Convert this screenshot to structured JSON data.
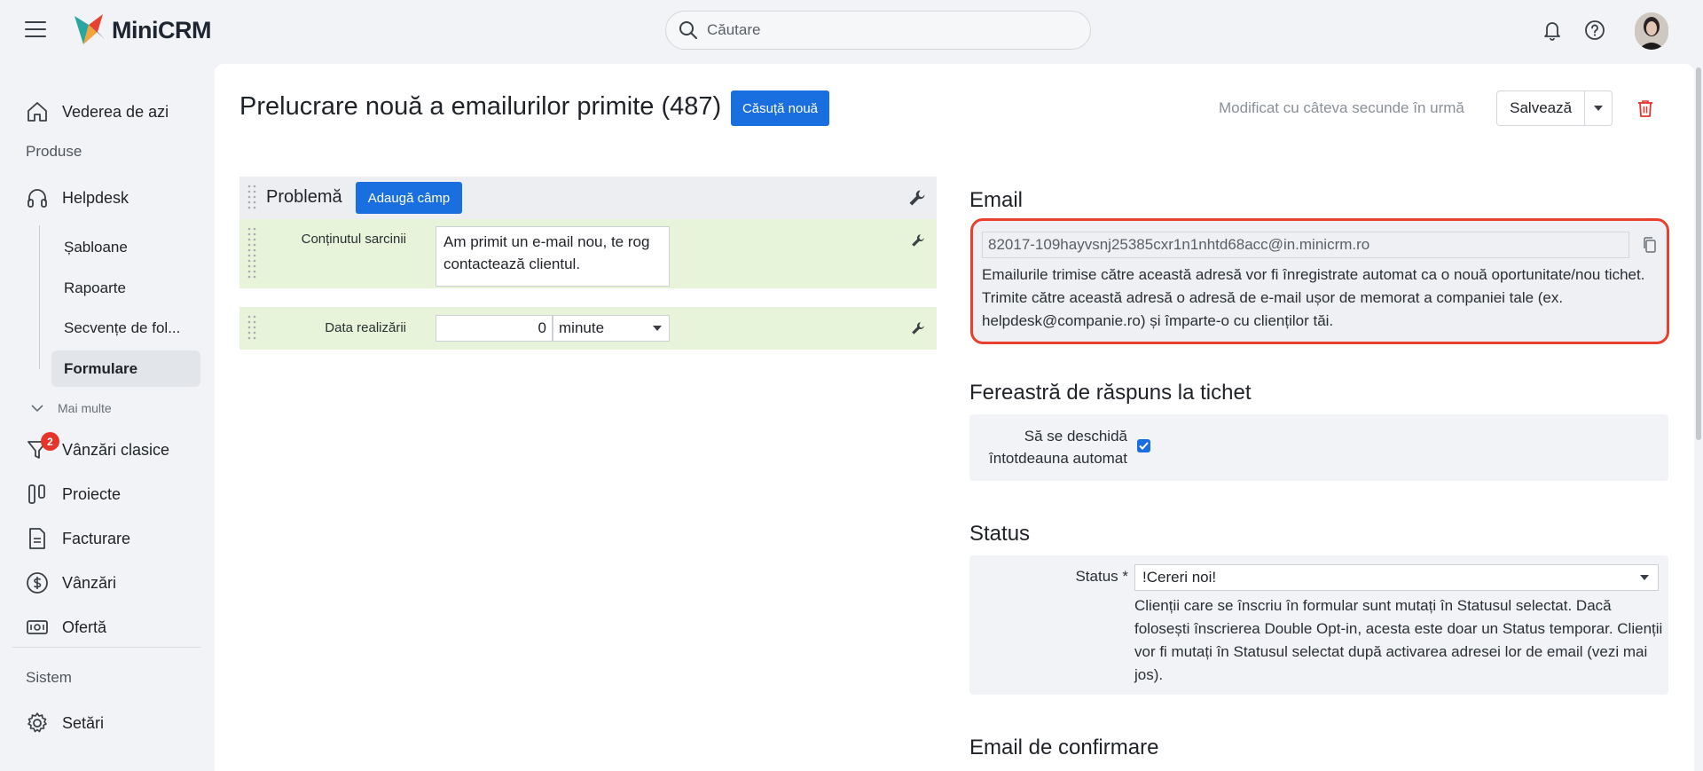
{
  "app": {
    "name": "MiniCRM"
  },
  "search": {
    "placeholder": "Căutare"
  },
  "topbar": {
    "icons": [
      "menu-icon",
      "bell-icon",
      "help-icon"
    ]
  },
  "sidebar": {
    "today": "Vederea de azi",
    "products_label": "Produse",
    "helpdesk": "Helpdesk",
    "sub_items": [
      "Șabloane",
      "Rapoarte",
      "Secvențe de fol...",
      "Formulare"
    ],
    "more": "Mai multe",
    "classic_sales": "Vânzări clasice",
    "classic_sales_badge": "2",
    "projects": "Proiecte",
    "invoicing": "Facturare",
    "sales": "Vânzări",
    "offer": "Ofertă",
    "system_label": "Sistem",
    "settings": "Setări"
  },
  "header": {
    "title": "Prelucrare nouă a emailurilor primite (487)",
    "new_box_label": "Căsuță nouă",
    "modified": "Modificat cu câteva secunde în urmă",
    "save_label": "Salvează"
  },
  "form": {
    "section_title": "Problemă",
    "add_field_label": "Adaugă câmp",
    "fields": [
      {
        "label": "Conținutul sarcinii",
        "value": "Am primit un e-mail nou, te rog contactează clientul."
      },
      {
        "label": "Data realizării",
        "number": "0",
        "unit": "minute"
      }
    ]
  },
  "email": {
    "title": "Email",
    "address": "82017-109hayvsnj25385cxr1n1nhtd68acc@in.minicrm.ro",
    "description": "Emailurile trimise către această adresă vor fi înregistrate automat ca o nouă oportunitate/nou tichet. Trimite către această adresă o adresă de e-mail ușor de memorat a companiei tale (ex. helpdesk@companie.ro) și împarte-o cu clienților tăi."
  },
  "reply_window": {
    "title": "Fereastră de răspuns la tichet",
    "checkbox_label": "Să se deschidă întotdeauna automat",
    "checked": true
  },
  "status": {
    "title": "Status",
    "label": "Status *",
    "selected": "!Cereri noi!",
    "description": "Clienții care se înscriu în formular sunt mutați în Statusul selectat. Dacă folosești înscrierea Double Opt-in, acesta este doar un Status temporar. Clienții vor fi mutați în Statusul selectat după activarea adresei lor de email (vezi mai jos)."
  },
  "confirmation": {
    "title": "Email de confirmare"
  },
  "colors": {
    "accent": "#1a6fe0",
    "highlight": "#e8412f",
    "field_row": "#e7f4d9",
    "badge": "#e5342a"
  }
}
